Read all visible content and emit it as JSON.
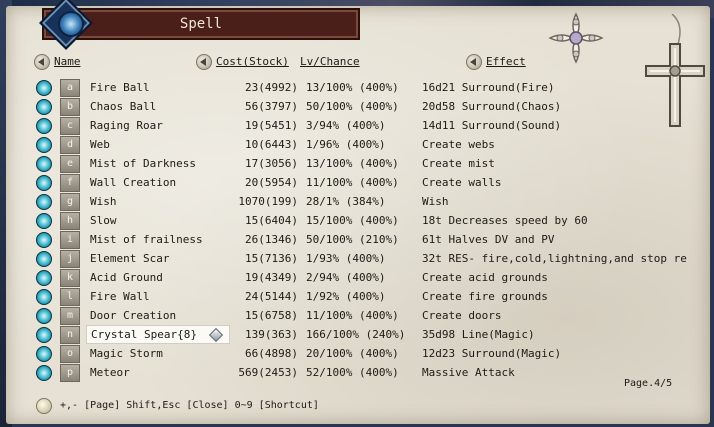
{
  "window": {
    "title": "Spell"
  },
  "columns": {
    "name": "Name",
    "cost": "Cost(Stock)",
    "lv": "Lv/Chance",
    "effect": "Effect"
  },
  "spells": [
    {
      "key": "a",
      "name": "Fire Ball",
      "cost": "23(4992)",
      "lv": "13/100% (400%)",
      "effect": "16d21 Surround(Fire)"
    },
    {
      "key": "b",
      "name": "Chaos Ball",
      "cost": "56(3797)",
      "lv": "50/100% (400%)",
      "effect": "20d58 Surround(Chaos)"
    },
    {
      "key": "c",
      "name": "Raging Roar",
      "cost": "19(5451)",
      "lv": "3/94% (400%)",
      "effect": "14d11 Surround(Sound)"
    },
    {
      "key": "d",
      "name": "Web",
      "cost": "10(6443)",
      "lv": "1/96% (400%)",
      "effect": "Create webs"
    },
    {
      "key": "e",
      "name": "Mist of Darkness",
      "cost": "17(3056)",
      "lv": "13/100% (400%)",
      "effect": "Create mist"
    },
    {
      "key": "f",
      "name": "Wall Creation",
      "cost": "20(5954)",
      "lv": "11/100% (400%)",
      "effect": "Create walls"
    },
    {
      "key": "g",
      "name": "Wish",
      "cost": "1070(199)",
      "lv": "28/1% (384%)",
      "effect": "Wish"
    },
    {
      "key": "h",
      "name": "Slow",
      "cost": "15(6404)",
      "lv": "15/100% (400%)",
      "effect": "18t Decreases speed by 60"
    },
    {
      "key": "i",
      "name": "Mist of frailness",
      "cost": "26(1346)",
      "lv": "50/100% (210%)",
      "effect": "61t Halves DV and PV"
    },
    {
      "key": "j",
      "name": "Element Scar",
      "cost": "15(7136)",
      "lv": "1/93% (400%)",
      "effect": "32t RES- fire,cold,lightning,and stop re"
    },
    {
      "key": "k",
      "name": "Acid Ground",
      "cost": "19(4349)",
      "lv": "2/94% (400%)",
      "effect": "Create acid grounds"
    },
    {
      "key": "l",
      "name": "Fire Wall",
      "cost": "24(5144)",
      "lv": "1/92% (400%)",
      "effect": "Create fire grounds"
    },
    {
      "key": "m",
      "name": "Door Creation",
      "cost": "15(6758)",
      "lv": "11/100% (400%)",
      "effect": "Create doors"
    },
    {
      "key": "n",
      "name": "Crystal Spear{8}",
      "cost": "139(363)",
      "lv": "166/100% (240%)",
      "effect": "35d98 Line(Magic)",
      "selected": true
    },
    {
      "key": "o",
      "name": "Magic Storm",
      "cost": "66(4898)",
      "lv": "20/100% (400%)",
      "effect": "12d23 Surround(Magic)"
    },
    {
      "key": "p",
      "name": "Meteor",
      "cost": "569(2453)",
      "lv": "52/100% (400%)",
      "effect": "Massive Attack"
    }
  ],
  "page_indicator": "Page.4/5",
  "footer_hint": "+,- [Page]  Shift,Esc [Close]  0~9 [Shortcut]",
  "colors": {
    "title_bar": "#4a1f1a",
    "parchment": "#e6e1d4",
    "row_icon": "#38b0c8"
  },
  "icons": [
    "title-gem-icon",
    "spell-orb-icon",
    "page-arrow-icon",
    "hint-bulb-icon",
    "cross-ornament-icon"
  ]
}
